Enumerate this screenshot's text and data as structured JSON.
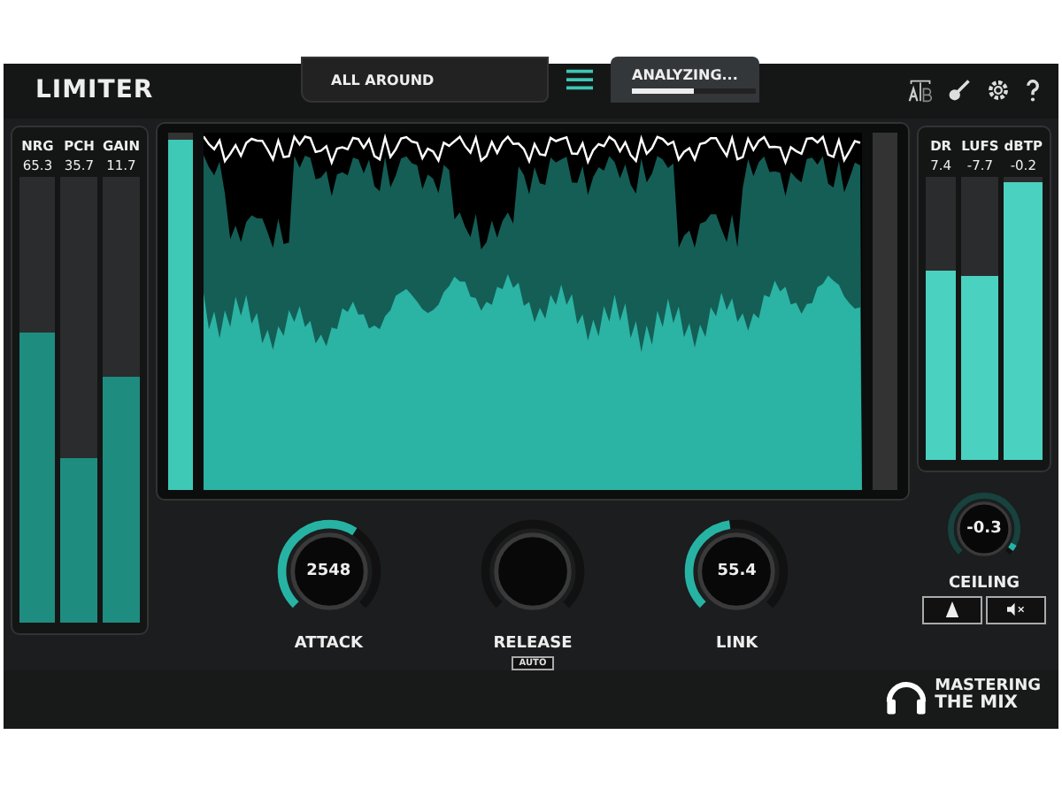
{
  "title": "LIMITER",
  "preset": {
    "label": "ALL AROUND"
  },
  "status": {
    "label": "ANALYZING...",
    "level": 0.5
  },
  "left_meters": [
    {
      "label": "NRG",
      "value": "65.3",
      "level": 0.65
    },
    {
      "label": "PCH",
      "value": "35.7",
      "level": 0.37
    },
    {
      "label": "GAIN",
      "value": "11.7",
      "level": 0.55
    }
  ],
  "input_meter": {
    "level": 0.98
  },
  "knobs": [
    {
      "label": "ATTACK",
      "value": "2548",
      "level": 0.62
    },
    {
      "label": "RELEASE",
      "badge": "AUTO"
    },
    {
      "label": "LINK",
      "value": "55.4",
      "level": 0.47
    }
  ],
  "right_meters": [
    {
      "label": "DR",
      "value": "7.4",
      "level": 0.67
    },
    {
      "label": "LUFS",
      "value": "-7.7",
      "level": 0.65
    },
    {
      "label": "dBTP",
      "value": "-0.2",
      "level": 0.98
    }
  ],
  "ceiling": {
    "label": "CEILING",
    "value": "-0.3",
    "level": 0.97
  },
  "logo": {
    "line_1": "MASTERING",
    "line_2": "THE MIX"
  }
}
